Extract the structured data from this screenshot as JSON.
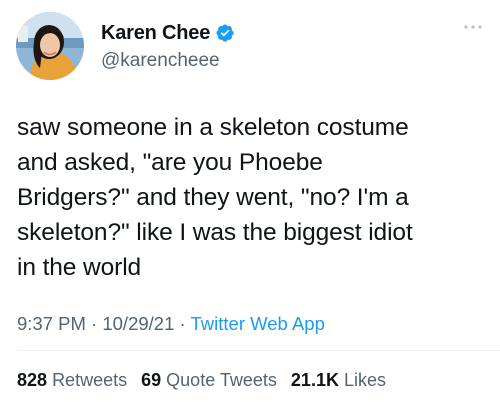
{
  "author": {
    "display_name": "Karen Chee",
    "handle": "@karencheee",
    "verified": true
  },
  "tweet": {
    "text": "saw someone in a skeleton costume\nand asked, \"are you Phoebe\nBridgers?\" and they went, \"no? I'm a\nskeleton?\" like I was the biggest idiot\nin the world",
    "time": "9:37 PM",
    "date": "10/29/21",
    "separator": "·",
    "source": "Twitter Web App"
  },
  "stats": {
    "retweets_count": "828",
    "retweets_label": "Retweets",
    "quotes_count": "69",
    "quotes_label": "Quote Tweets",
    "likes_count": "21.1K",
    "likes_label": "Likes"
  },
  "colors": {
    "text": "#0f1419",
    "secondary": "#536471",
    "accent": "#1d9bf0",
    "divider": "#eff3f4"
  },
  "icons": {
    "verified": "verified-badge-icon",
    "more": "more-options-icon"
  }
}
